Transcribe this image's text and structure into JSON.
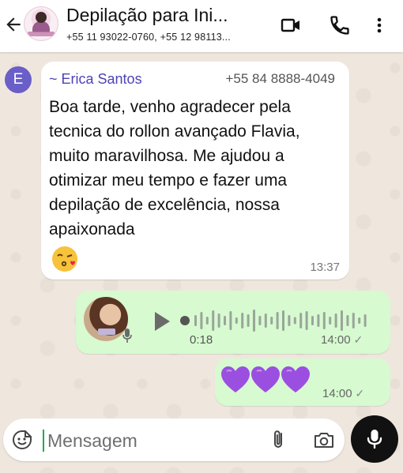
{
  "header": {
    "title": "Depilação para Ini...",
    "participants": "+55 11 93022-0760, +55 12 98113...",
    "icons": [
      "back-arrow-icon",
      "video-call-icon",
      "voice-call-icon",
      "more-options-icon"
    ]
  },
  "messages": {
    "incoming": {
      "avatar_initial": "E",
      "sender_name": "~ Erica Santos",
      "sender_phone": "+55 84 8888-4049",
      "text": "Boa tarde, venho agradecer pela tecnica do rollon avançado Flavia, muito maravilhosa. Me ajudou a otimizar meu tempo e fazer uma depilação de excelência, nossa apaixonada",
      "emoji": "face-blowing-kiss",
      "time": "13:37"
    },
    "voice_note": {
      "duration": "0:18",
      "time": "14:00",
      "status": "✓"
    },
    "hearts": {
      "count": 3,
      "color": "#9b4fe0",
      "time": "14:00",
      "status": "✓"
    }
  },
  "composer": {
    "placeholder": "Mensagem"
  },
  "colors": {
    "sender_name": "#4c43b6",
    "outgoing_bubble": "#d7fad0",
    "accent_green": "#1fa855"
  }
}
